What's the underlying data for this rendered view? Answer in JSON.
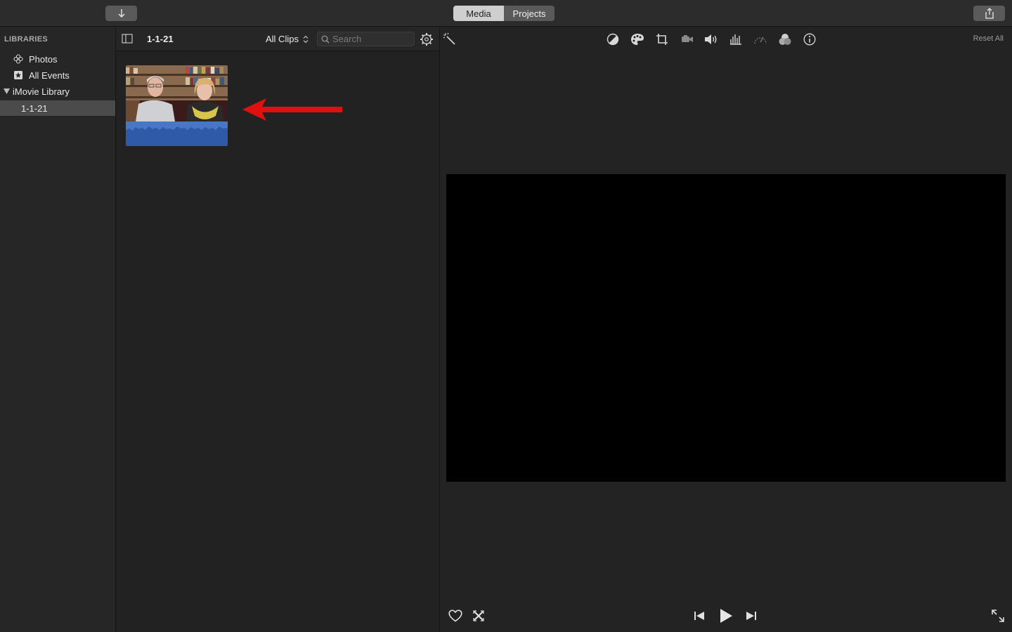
{
  "toolbar": {
    "import_icon": "arrow-down-icon",
    "tabs": [
      {
        "label": "Media",
        "selected": true
      },
      {
        "label": "Projects",
        "selected": false
      }
    ],
    "share_icon": "share-icon"
  },
  "sidebar": {
    "heading": "LIBRARIES",
    "items": [
      {
        "label": "Photos",
        "icon": "photos-icon"
      },
      {
        "label": "All Events",
        "icon": "star-icon"
      },
      {
        "label": "iMovie Library",
        "icon": "disclosure-triangle-icon"
      },
      {
        "label": "1-1-21",
        "selected": true
      }
    ]
  },
  "browser": {
    "event_title": "1-1-21",
    "filter_label": "All Clips",
    "search_placeholder": "Search"
  },
  "viewer": {
    "reset_label": "Reset All",
    "adjust_icons": [
      "color-balance-icon",
      "color-correction-icon",
      "crop-icon",
      "stabilization-icon",
      "volume-icon",
      "noise-reduction-icon",
      "speed-icon",
      "clip-filter-icon",
      "info-icon"
    ]
  },
  "colors": {
    "accent_audio": "#4a76c8",
    "annotation_arrow": "#e01010"
  }
}
